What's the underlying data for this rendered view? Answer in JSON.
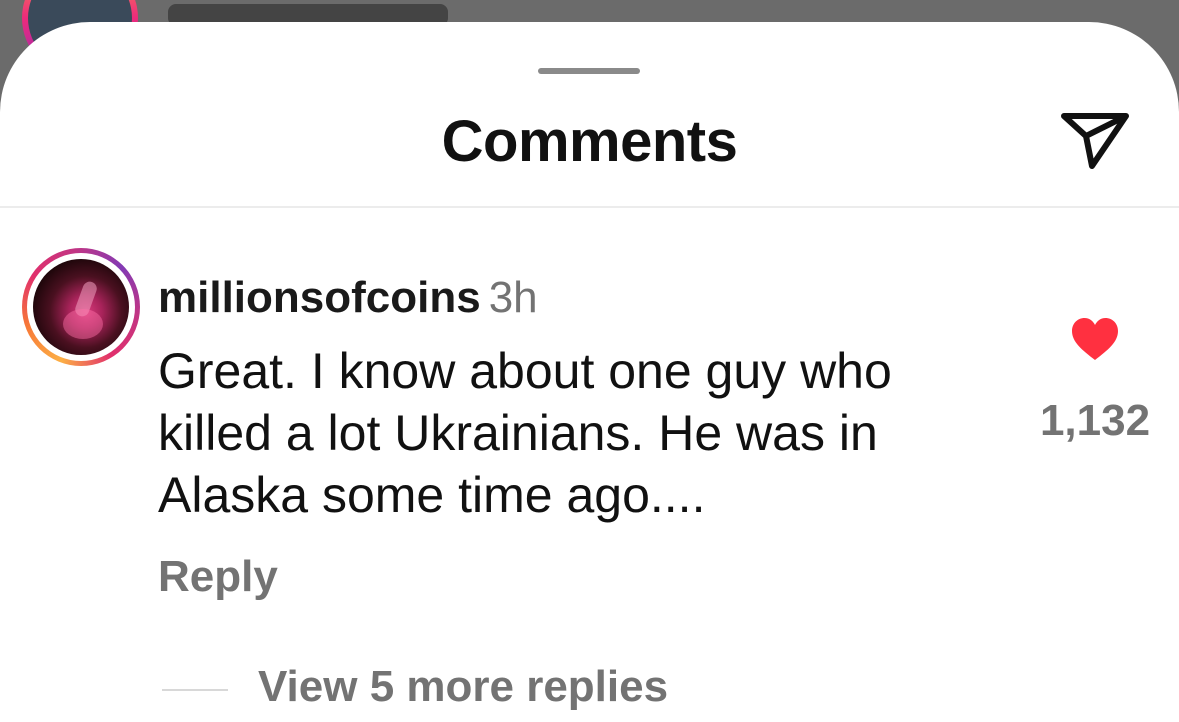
{
  "sheet": {
    "title": "Comments",
    "share_icon": "paper-plane-icon"
  },
  "comment": {
    "username": "millionsofcoins",
    "timestamp": "3h",
    "text": "Great. I know about one guy who\nkilled a lot Ukrainians. He was in\nAlaska some time ago....",
    "reply_label": "Reply",
    "view_replies_label": "View 5 more replies",
    "like_icon": "heart-filled-icon",
    "like_color": "#ff3040",
    "like_count": "1,132"
  },
  "colors": {
    "secondary_text": "#737373",
    "primary_text": "#111111"
  }
}
